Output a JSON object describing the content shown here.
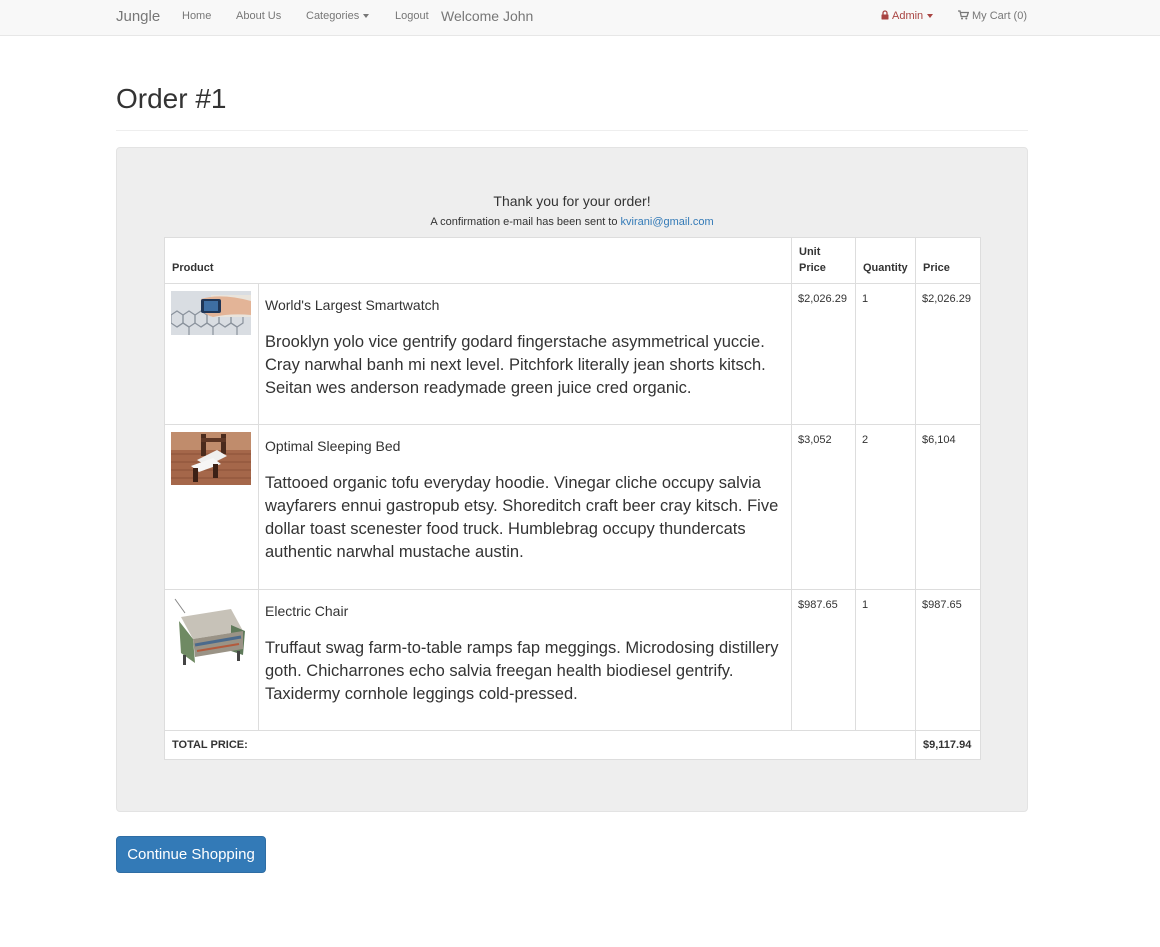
{
  "navbar": {
    "brand": "Jungle",
    "links": [
      "Home",
      "About Us",
      "Categories",
      "Logout"
    ],
    "welcome": "Welcome John",
    "admin_label": "Admin",
    "cart_label": "My Cart (0)",
    "admin_color": "#a94442"
  },
  "page": {
    "title": "Order #1"
  },
  "order": {
    "thanks": "Thank you for your order!",
    "confirm_text": "A confirmation e-mail has been sent to ",
    "email": "kvirani@gmail.com",
    "headers": {
      "product": "Product",
      "unit_price": "Unit Price",
      "quantity": "Quantity",
      "price": "Price"
    },
    "items": [
      {
        "name": "World's Largest Smartwatch",
        "description": "Brooklyn yolo vice gentrify godard fingerstache asymmetrical yuccie. Cray narwhal banh mi next level. Pitchfork literally jean shorts kitsch. Seitan wes anderson readymade green juice cred organic.",
        "unit_price": "$2,026.29",
        "quantity": "1",
        "price": "$2,026.29"
      },
      {
        "name": "Optimal Sleeping Bed",
        "description": "Tattooed organic tofu everyday hoodie. Vinegar cliche occupy salvia wayfarers ennui gastropub etsy. Shoreditch craft beer cray kitsch. Five dollar toast scenester food truck. Humblebrag occupy thundercats authentic narwhal mustache austin.",
        "unit_price": "$3,052",
        "quantity": "2",
        "price": "$6,104"
      },
      {
        "name": "Electric Chair",
        "description": "Truffaut swag farm-to-table ramps fap meggings. Microdosing distillery goth. Chicharrones echo salvia freegan health biodiesel gentrify. Taxidermy cornhole leggings cold-pressed.",
        "unit_price": "$987.65",
        "quantity": "1",
        "price": "$987.65"
      }
    ],
    "total_label": "TOTAL PRICE:",
    "total_value": "$9,117.94"
  },
  "actions": {
    "continue_label": "Continue Shopping",
    "primary_color": "#337ab7"
  }
}
